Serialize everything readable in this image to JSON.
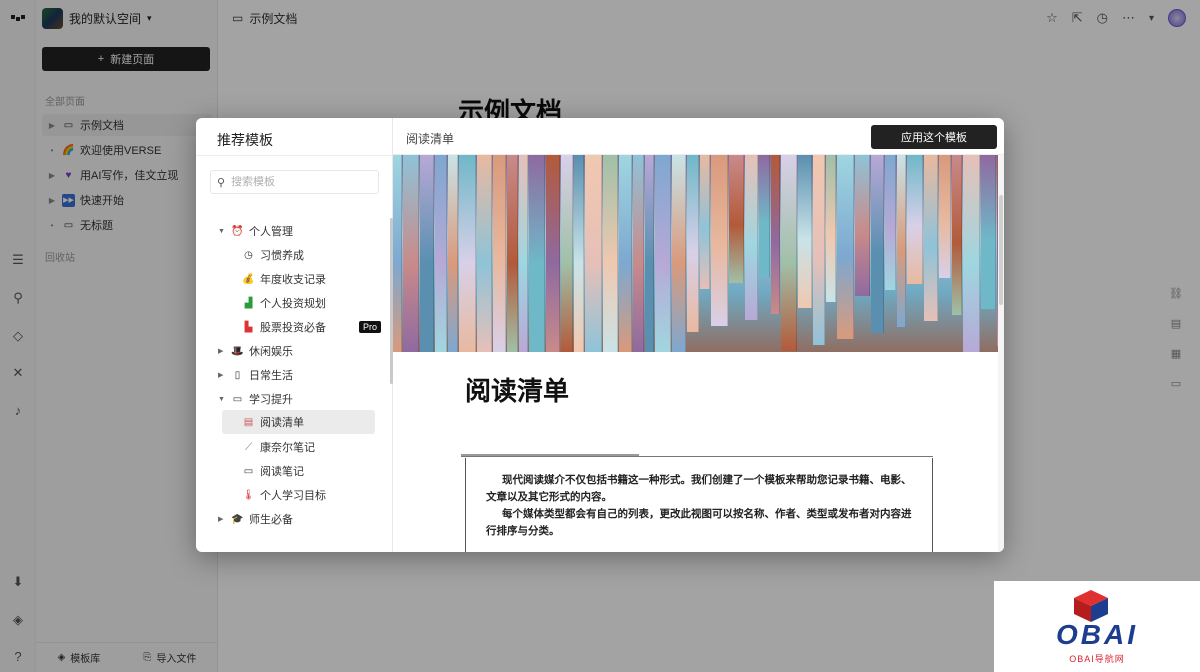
{
  "app": {
    "workspace_name": "我的默认空间",
    "new_page_label": "新建页面",
    "all_pages_label": "全部页面",
    "trash_label": "回收站",
    "pages": [
      {
        "label": "示例文档",
        "icon": "doc-icon"
      },
      {
        "label": "欢迎使用VERSE",
        "icon": "rainbow-icon"
      },
      {
        "label": "用AI写作，佳文立现",
        "icon": "heart-icon"
      },
      {
        "label": "快速开始",
        "icon": "fast-forward-icon"
      },
      {
        "label": "无标题",
        "icon": "doc-icon"
      }
    ],
    "bottom": {
      "templates_label": "模板库",
      "import_label": "导入文件"
    },
    "doc_title": "示例文档",
    "bg_heading": "示例文档",
    "accent": "#222222"
  },
  "modal": {
    "left_title": "推荐模板",
    "search_placeholder": "搜索模板",
    "tree": [
      {
        "label": "个人管理",
        "icon": "alarm-clock-icon",
        "expanded": true,
        "level": 0
      },
      {
        "label": "习惯养成",
        "icon": "clock-icon",
        "level": 1
      },
      {
        "label": "年度收支记录",
        "icon": "money-bag-icon",
        "level": 1
      },
      {
        "label": "个人投资规划",
        "icon": "chart-up-icon",
        "level": 1
      },
      {
        "label": "股票投资必备",
        "icon": "chart-down-icon",
        "level": 1,
        "badge": "Pro"
      },
      {
        "label": "休闲娱乐",
        "icon": "hat-icon",
        "expanded": false,
        "level": 0
      },
      {
        "label": "日常生活",
        "icon": "calendar-icon",
        "expanded": false,
        "level": 0
      },
      {
        "label": "学习提升",
        "icon": "monitor-icon",
        "expanded": true,
        "level": 0
      },
      {
        "label": "阅读清单",
        "icon": "books-icon",
        "level": 1,
        "selected": true
      },
      {
        "label": "康奈尔笔记",
        "icon": "pen-icon",
        "level": 1
      },
      {
        "label": "阅读笔记",
        "icon": "monitor-icon",
        "level": 1
      },
      {
        "label": "个人学习目标",
        "icon": "thermometer-icon",
        "level": 1
      },
      {
        "label": "师生必备",
        "icon": "graduation-cap-icon",
        "expanded": false,
        "level": 0
      }
    ],
    "right_title": "阅读清单",
    "apply_label": "应用这个模板",
    "preview_title": "阅读清单",
    "preview_paragraphs": [
      "现代阅读媒介不仅包括书籍这一种形式。我们创建了一个模板来帮助您记录书籍、电影、文章以及其它形式的内容。",
      "每个媒体类型都会有自己的列表，更改此视图可以按名称、作者、类型或发布者对内容进行排序与分类。"
    ]
  },
  "watermark": {
    "logo": "OBAI",
    "sub": "OBAI导航网"
  }
}
